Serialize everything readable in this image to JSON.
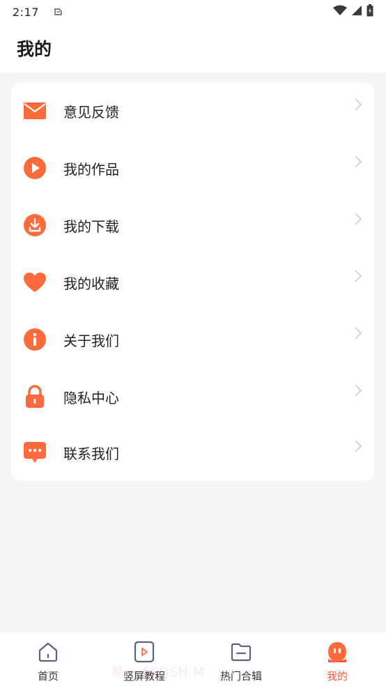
{
  "status_bar": {
    "time": "2:17"
  },
  "header": {
    "title": "我的"
  },
  "menu": {
    "items": [
      {
        "label": "意见反馈",
        "icon": "mail-icon"
      },
      {
        "label": "我的作品",
        "icon": "play-icon"
      },
      {
        "label": "我的下载",
        "icon": "download-icon"
      },
      {
        "label": "我的收藏",
        "icon": "heart-icon"
      },
      {
        "label": "关于我们",
        "icon": "info-icon"
      },
      {
        "label": "隐私中心",
        "icon": "lock-icon"
      },
      {
        "label": "联系我们",
        "icon": "chat-icon"
      }
    ]
  },
  "tabbar": {
    "tabs": [
      {
        "label": "首页",
        "icon": "home-icon",
        "active": false
      },
      {
        "label": "竖屏教程",
        "icon": "video-icon",
        "active": false
      },
      {
        "label": "热门合辑",
        "icon": "folder-icon",
        "active": false
      },
      {
        "label": "我的",
        "icon": "profile-icon",
        "active": true
      }
    ]
  },
  "watermark": "易 • EEDSH M",
  "colors": {
    "accent": "#ff6a3d",
    "tab_active": "#ff5a3c",
    "tab_icon": "#5b6280",
    "chevron": "#c8cddc"
  }
}
